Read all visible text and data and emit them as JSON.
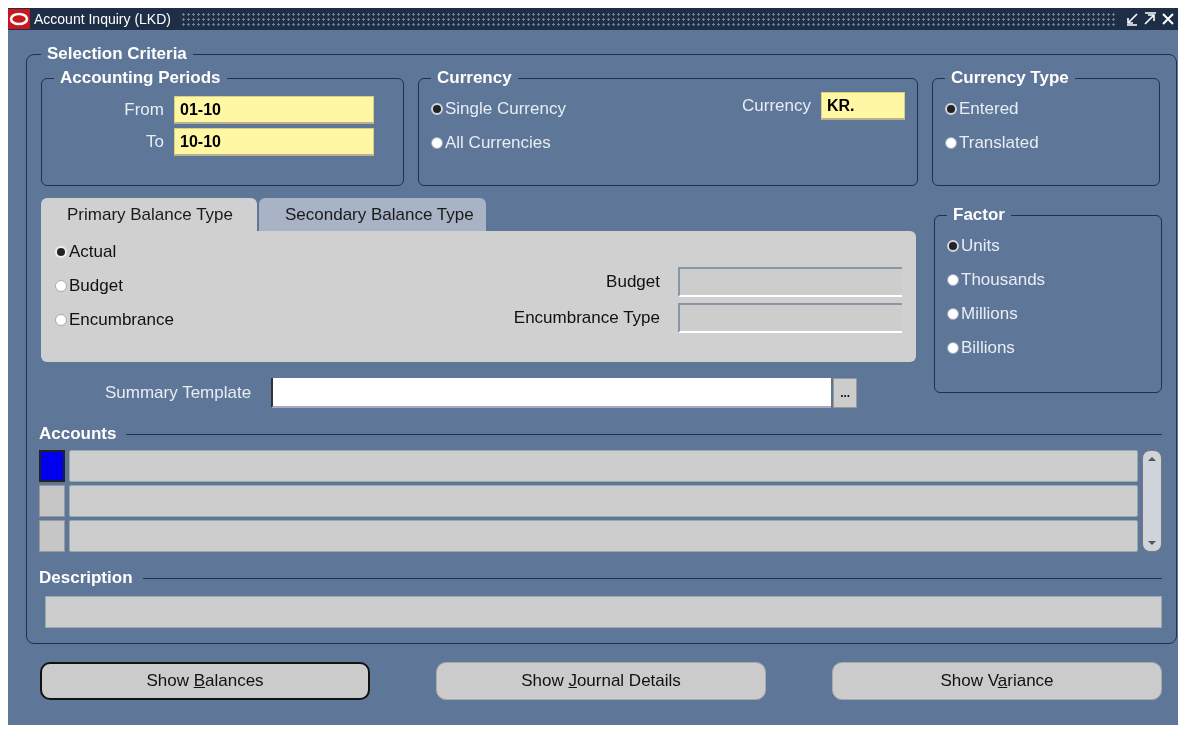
{
  "window": {
    "title": "Account Inquiry (LKD)"
  },
  "selection_criteria": {
    "title": "Selection Criteria",
    "accounting_periods": {
      "title": "Accounting Periods",
      "fields": [
        {
          "label": "From",
          "value": "01-10"
        },
        {
          "label": "To",
          "value": "10-10"
        }
      ]
    },
    "currency": {
      "title": "Currency",
      "options": [
        {
          "label": "Single Currency",
          "selected": true
        },
        {
          "label": "All Currencies",
          "selected": false
        }
      ],
      "field": {
        "label": "Currency",
        "value": "KR."
      }
    },
    "currency_type": {
      "title": "Currency Type",
      "options": [
        {
          "label": "Entered",
          "selected": true
        },
        {
          "label": "Translated",
          "selected": false
        }
      ]
    },
    "tabs": [
      {
        "label": "Primary Balance Type",
        "selected": true
      },
      {
        "label": "Secondary Balance Type",
        "selected": false
      }
    ],
    "balance_type": {
      "options": [
        {
          "label": "Actual",
          "selected": true
        },
        {
          "label": "Budget",
          "selected": false
        },
        {
          "label": "Encumbrance",
          "selected": false
        }
      ],
      "fields": [
        {
          "label": "Budget",
          "disabled": true
        },
        {
          "label": "Encumbrance Type",
          "disabled": true
        }
      ]
    },
    "factor": {
      "title": "Factor",
      "options": [
        {
          "label": "Units",
          "selected": true
        },
        {
          "label": "Thousands",
          "selected": false
        },
        {
          "label": "Millions",
          "selected": false
        },
        {
          "label": "Billions",
          "selected": false
        }
      ]
    },
    "summary_template": {
      "label": "Summary Template",
      "lov_button": "..."
    },
    "accounts": {
      "title": "Accounts",
      "rows": [
        {
          "selected": true
        },
        {
          "selected": false
        },
        {
          "selected": false
        }
      ]
    },
    "description": {
      "title": "Description"
    }
  },
  "buttons": [
    {
      "before": "Show ",
      "key": "B",
      "after": "alances",
      "focused": true
    },
    {
      "before": "Show ",
      "key": "J",
      "after": "ournal Details",
      "focused": false
    },
    {
      "before": "Show V",
      "key": "a",
      "after": "riance",
      "focused": false
    }
  ]
}
